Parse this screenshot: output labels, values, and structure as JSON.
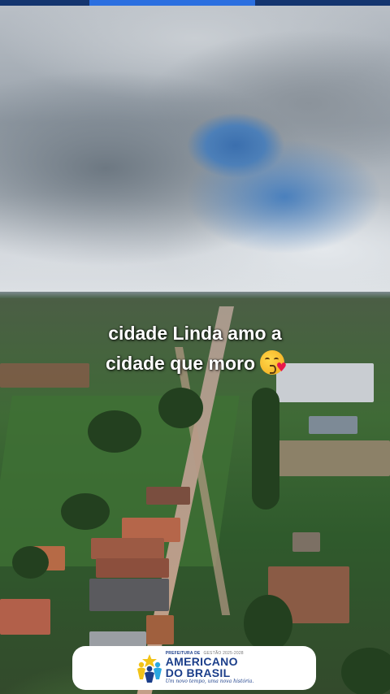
{
  "story": {
    "progress_fraction": 0.55
  },
  "caption": {
    "line1": "cidade Linda amo a",
    "line2": "cidade que moro",
    "emoji": "face-blowing-a-kiss-emoji"
  },
  "banner": {
    "prefix": "PREFEITURA DE",
    "years": "GESTÃO 2025-2028",
    "name_line1": "AMERICANO",
    "name_line2": "DO BRASIL",
    "slogan": "Um novo tempo, uma nova história.",
    "logo_icon": "people-star-logo-icon",
    "colors": {
      "navy": "#1b3e8a",
      "yellow": "#f2c318",
      "blue": "#2aa8e0"
    }
  }
}
